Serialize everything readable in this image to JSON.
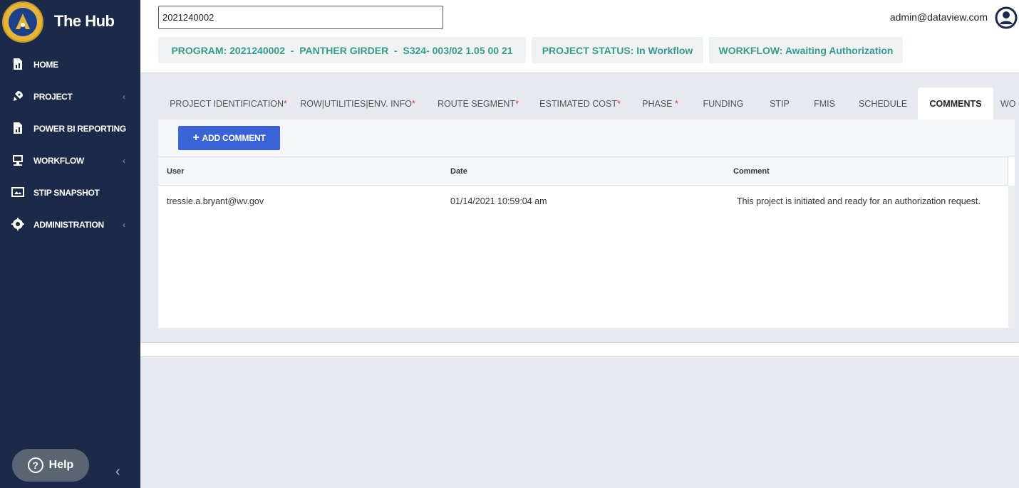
{
  "app": {
    "title": "The Hub"
  },
  "sidebar": {
    "items": [
      {
        "label": "HOME",
        "icon": "document-icon",
        "has_children": false
      },
      {
        "label": "PROJECT",
        "icon": "rocket-icon",
        "has_children": true
      },
      {
        "label": "POWER BI REPORTING",
        "icon": "report-icon",
        "has_children": true
      },
      {
        "label": "WORKFLOW",
        "icon": "workflow-icon",
        "has_children": true
      },
      {
        "label": "STIP SNAPSHOT",
        "icon": "snapshot-icon",
        "has_children": false
      },
      {
        "label": "ADMINISTRATION",
        "icon": "gear-icon",
        "has_children": true
      }
    ],
    "chevron": "‹",
    "help_label": "Help",
    "help_glyph": "?",
    "collapse_glyph": "‹"
  },
  "header": {
    "search_value": "2021240002",
    "user_email": "admin@dataview.com",
    "program_pill": "PROGRAM: 2021240002  -  PANTHER GIRDER  -  S324- 003/02 1.05 00 21",
    "status_pill": "PROJECT STATUS: In Workflow",
    "workflow_pill": "WORKFLOW: Awaiting Authorization"
  },
  "tabs": [
    {
      "label": "PROJECT IDENTIFICATION",
      "required": "*"
    },
    {
      "label": "ROW|UTILITIES|ENV. INFO",
      "required": "*"
    },
    {
      "label": "ROUTE SEGMENT",
      "required": "*"
    },
    {
      "label": "ESTIMATED COST",
      "required": "*"
    },
    {
      "label": "PHASE ",
      "required": "*"
    },
    {
      "label": "FUNDING",
      "required": ""
    },
    {
      "label": "STIP",
      "required": ""
    },
    {
      "label": "FMIS",
      "required": ""
    },
    {
      "label": "SCHEDULE",
      "required": ""
    },
    {
      "label": "COMMENTS",
      "required": "",
      "active": true
    },
    {
      "label": "WO",
      "required": ""
    }
  ],
  "comments": {
    "add_button": {
      "glyph": "+",
      "label": "ADD COMMENT"
    },
    "columns": [
      "User",
      "Date",
      "Comment"
    ],
    "rows": [
      {
        "user": "tressie.a.bryant@wv.gov",
        "date": "01/14/2021 10:59:04 am",
        "comment": "This project is initiated and ready for an authorization request."
      }
    ]
  },
  "colors": {
    "sidebar_bg": "#1c2a4a",
    "accent_blue": "#3a63d8",
    "pill_text": "#3a9a8a",
    "required": "#e53935"
  }
}
